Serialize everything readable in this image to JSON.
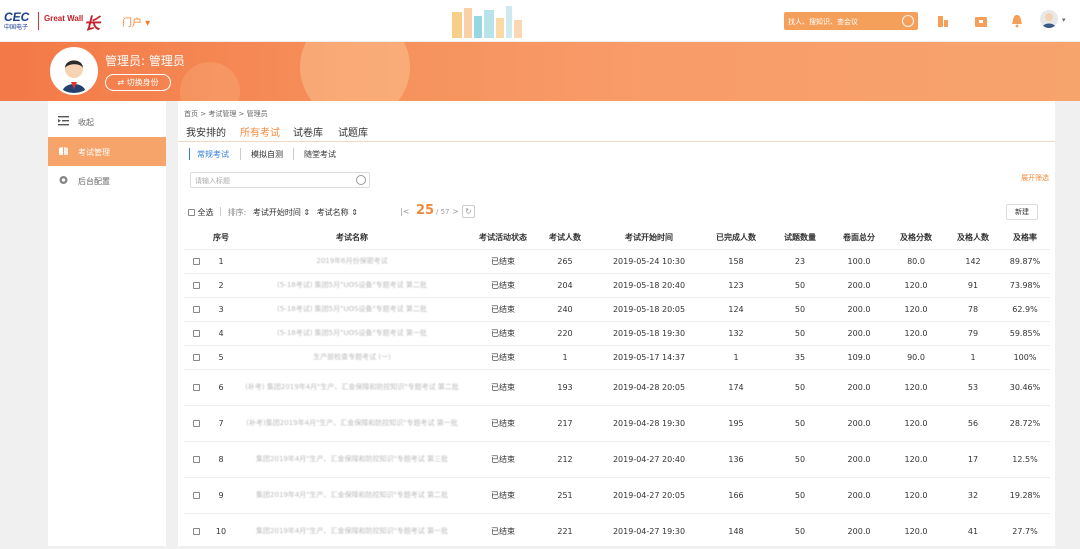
{
  "header": {
    "logo_cec": "CEC",
    "logo_cec_sub": "中国电子",
    "logo_gw": "Great Wall",
    "logo_mark": "长",
    "portal_label": "门户 ▾",
    "search_placeholder": "找人、搜知识、查会议"
  },
  "banner": {
    "user_name": "管理员: 管理员",
    "switch_label": "⇄ 切换身份"
  },
  "sidebar": {
    "items": [
      {
        "label": "收起",
        "icon": "menu-fold-icon"
      },
      {
        "label": "考试管理",
        "icon": "exam-icon",
        "active": true
      },
      {
        "label": "后台配置",
        "icon": "gear-icon"
      }
    ]
  },
  "breadcrumb": "首页 > 考试管理 > 管理员",
  "tabs": [
    {
      "label": "我安排的",
      "active": false
    },
    {
      "label": "所有考试",
      "active": true
    },
    {
      "label": "试卷库",
      "active": false
    },
    {
      "label": "试题库",
      "active": false
    }
  ],
  "subtabs": [
    {
      "label": "常规考试",
      "active": true
    },
    {
      "label": "模拟自测",
      "active": false
    },
    {
      "label": "随堂考试",
      "active": false
    }
  ],
  "filter": {
    "search_placeholder": "请输入标题",
    "expand_label": "展开筛选"
  },
  "toolbar": {
    "select_all": "全选",
    "sort_label": "排序:",
    "sort_time": "考试开始时间 ⇕",
    "sort_name": "考试名称 ⇕",
    "page_current": "25",
    "page_total": "/ 57",
    "new_label": "新建"
  },
  "table": {
    "headers": [
      "序号",
      "考试名称",
      "考试活动状态",
      "考试人数",
      "考试开始时间",
      "已完成人数",
      "试题数量",
      "卷面总分",
      "及格分数",
      "及格人数",
      "及格率"
    ],
    "rows": [
      {
        "no": "1",
        "name": "2019年6月份保密考试",
        "status": "已结束",
        "count": "265",
        "start": "2019-05-24 10:30",
        "done": "158",
        "qnum": "23",
        "total": "100.0",
        "pass_score": "80.0",
        "pass_count": "142",
        "rate": "89.87%"
      },
      {
        "no": "2",
        "name": "(5-18考试) 集团5月\"UOS设备\"专题考试 第二批",
        "status": "已结束",
        "count": "204",
        "start": "2019-05-18 20:40",
        "done": "123",
        "qnum": "50",
        "total": "200.0",
        "pass_score": "120.0",
        "pass_count": "91",
        "rate": "73.98%"
      },
      {
        "no": "3",
        "name": "(5-18考试) 集团5月\"UOS设备\"专题考试 第二批",
        "status": "已结束",
        "count": "240",
        "start": "2019-05-18 20:05",
        "done": "124",
        "qnum": "50",
        "total": "200.0",
        "pass_score": "120.0",
        "pass_count": "78",
        "rate": "62.9%"
      },
      {
        "no": "4",
        "name": "(5-18考试) 集团5月\"UOS设备\"专题考试 第一批",
        "status": "已结束",
        "count": "220",
        "start": "2019-05-18 19:30",
        "done": "132",
        "qnum": "50",
        "total": "200.0",
        "pass_score": "120.0",
        "pass_count": "79",
        "rate": "59.85%"
      },
      {
        "no": "5",
        "name": "生产部检查专题考试 (一)",
        "status": "已结束",
        "count": "1",
        "start": "2019-05-17 14:37",
        "done": "1",
        "qnum": "35",
        "total": "109.0",
        "pass_score": "90.0",
        "pass_count": "1",
        "rate": "100%"
      },
      {
        "no": "6",
        "name": "(补考) 集团2019年4月\"生产、汇金保障和防控知识\"专题考试 第二批",
        "status": "已结束",
        "count": "193",
        "start": "2019-04-28 20:05",
        "done": "174",
        "qnum": "50",
        "total": "200.0",
        "pass_score": "120.0",
        "pass_count": "53",
        "rate": "30.46%"
      },
      {
        "no": "7",
        "name": "(补考)集团2019年4月\"生产、汇金保障和防控知识\"专题考试 第一批",
        "status": "已结束",
        "count": "217",
        "start": "2019-04-28 19:30",
        "done": "195",
        "qnum": "50",
        "total": "200.0",
        "pass_score": "120.0",
        "pass_count": "56",
        "rate": "28.72%"
      },
      {
        "no": "8",
        "name": "集团2019年4月\"生产、汇金保障和防控知识\"专题考试 第三批",
        "status": "已结束",
        "count": "212",
        "start": "2019-04-27 20:40",
        "done": "136",
        "qnum": "50",
        "total": "200.0",
        "pass_score": "120.0",
        "pass_count": "17",
        "rate": "12.5%"
      },
      {
        "no": "9",
        "name": "集团2019年4月\"生产、汇金保障和防控知识\"专题考试 第二批",
        "status": "已结束",
        "count": "251",
        "start": "2019-04-27 20:05",
        "done": "166",
        "qnum": "50",
        "total": "200.0",
        "pass_score": "120.0",
        "pass_count": "32",
        "rate": "19.28%"
      },
      {
        "no": "10",
        "name": "集团2019年4月\"生产、汇金保障和防控知识\"专题考试 第一批",
        "status": "已结束",
        "count": "221",
        "start": "2019-04-27 19:30",
        "done": "148",
        "qnum": "50",
        "total": "200.0",
        "pass_score": "120.0",
        "pass_count": "41",
        "rate": "27.7%"
      }
    ]
  },
  "colors": {
    "accent": "#f28a3d",
    "banner": "#f6915c",
    "active_subtab": "#2f7de1"
  }
}
